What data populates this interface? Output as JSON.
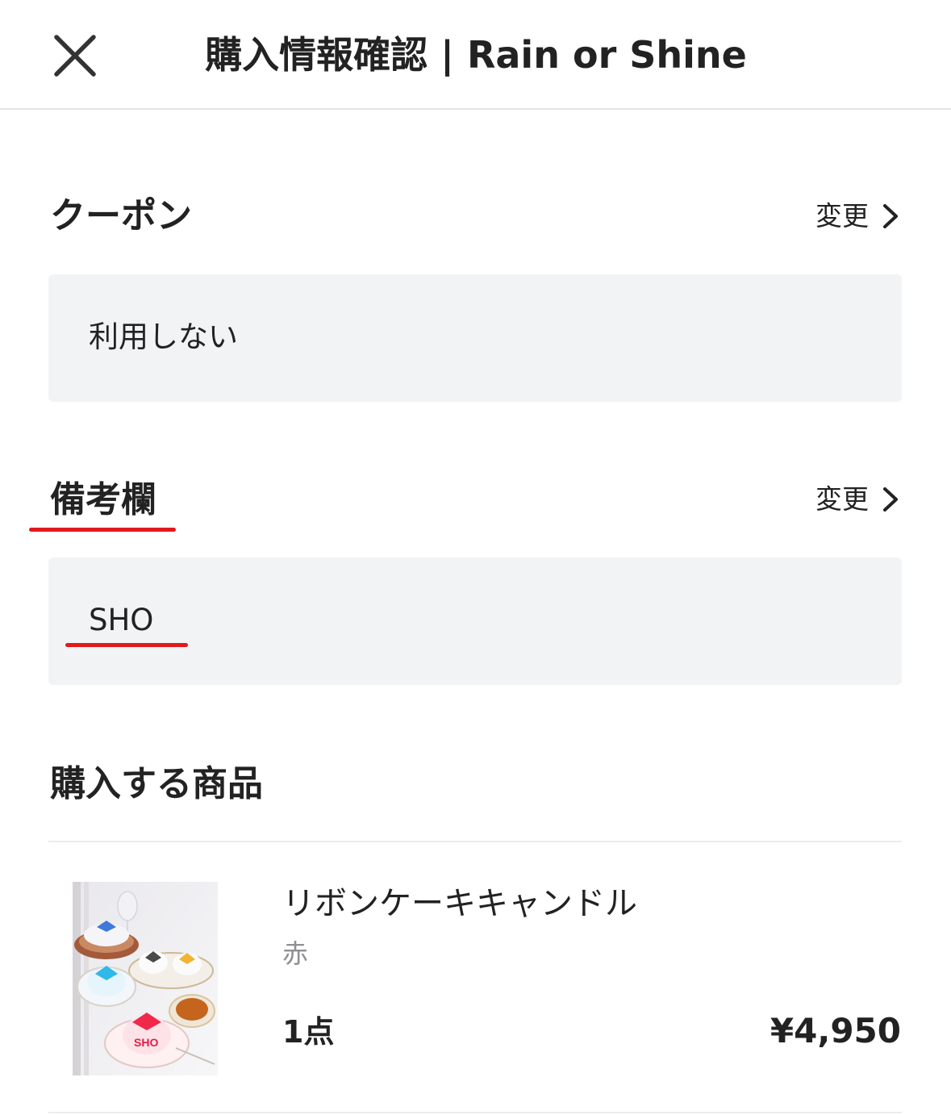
{
  "header": {
    "title": "購入情報確認 | Rain or Shine",
    "close_icon": "close-icon"
  },
  "coupon": {
    "title": "クーポン",
    "change_label": "変更",
    "value": "利用しない"
  },
  "remarks": {
    "title": "備考欄",
    "change_label": "変更",
    "value": "SHO"
  },
  "products": {
    "title": "購入する商品",
    "items": [
      {
        "name": "リボンケーキキャンドル",
        "variant": "赤",
        "quantity": "1点",
        "price": "¥4,950"
      }
    ]
  },
  "colors": {
    "highlight_underline": "#e0191b",
    "box_background": "#f2f3f5",
    "text": "#222222",
    "muted_text": "#8e8e93"
  }
}
